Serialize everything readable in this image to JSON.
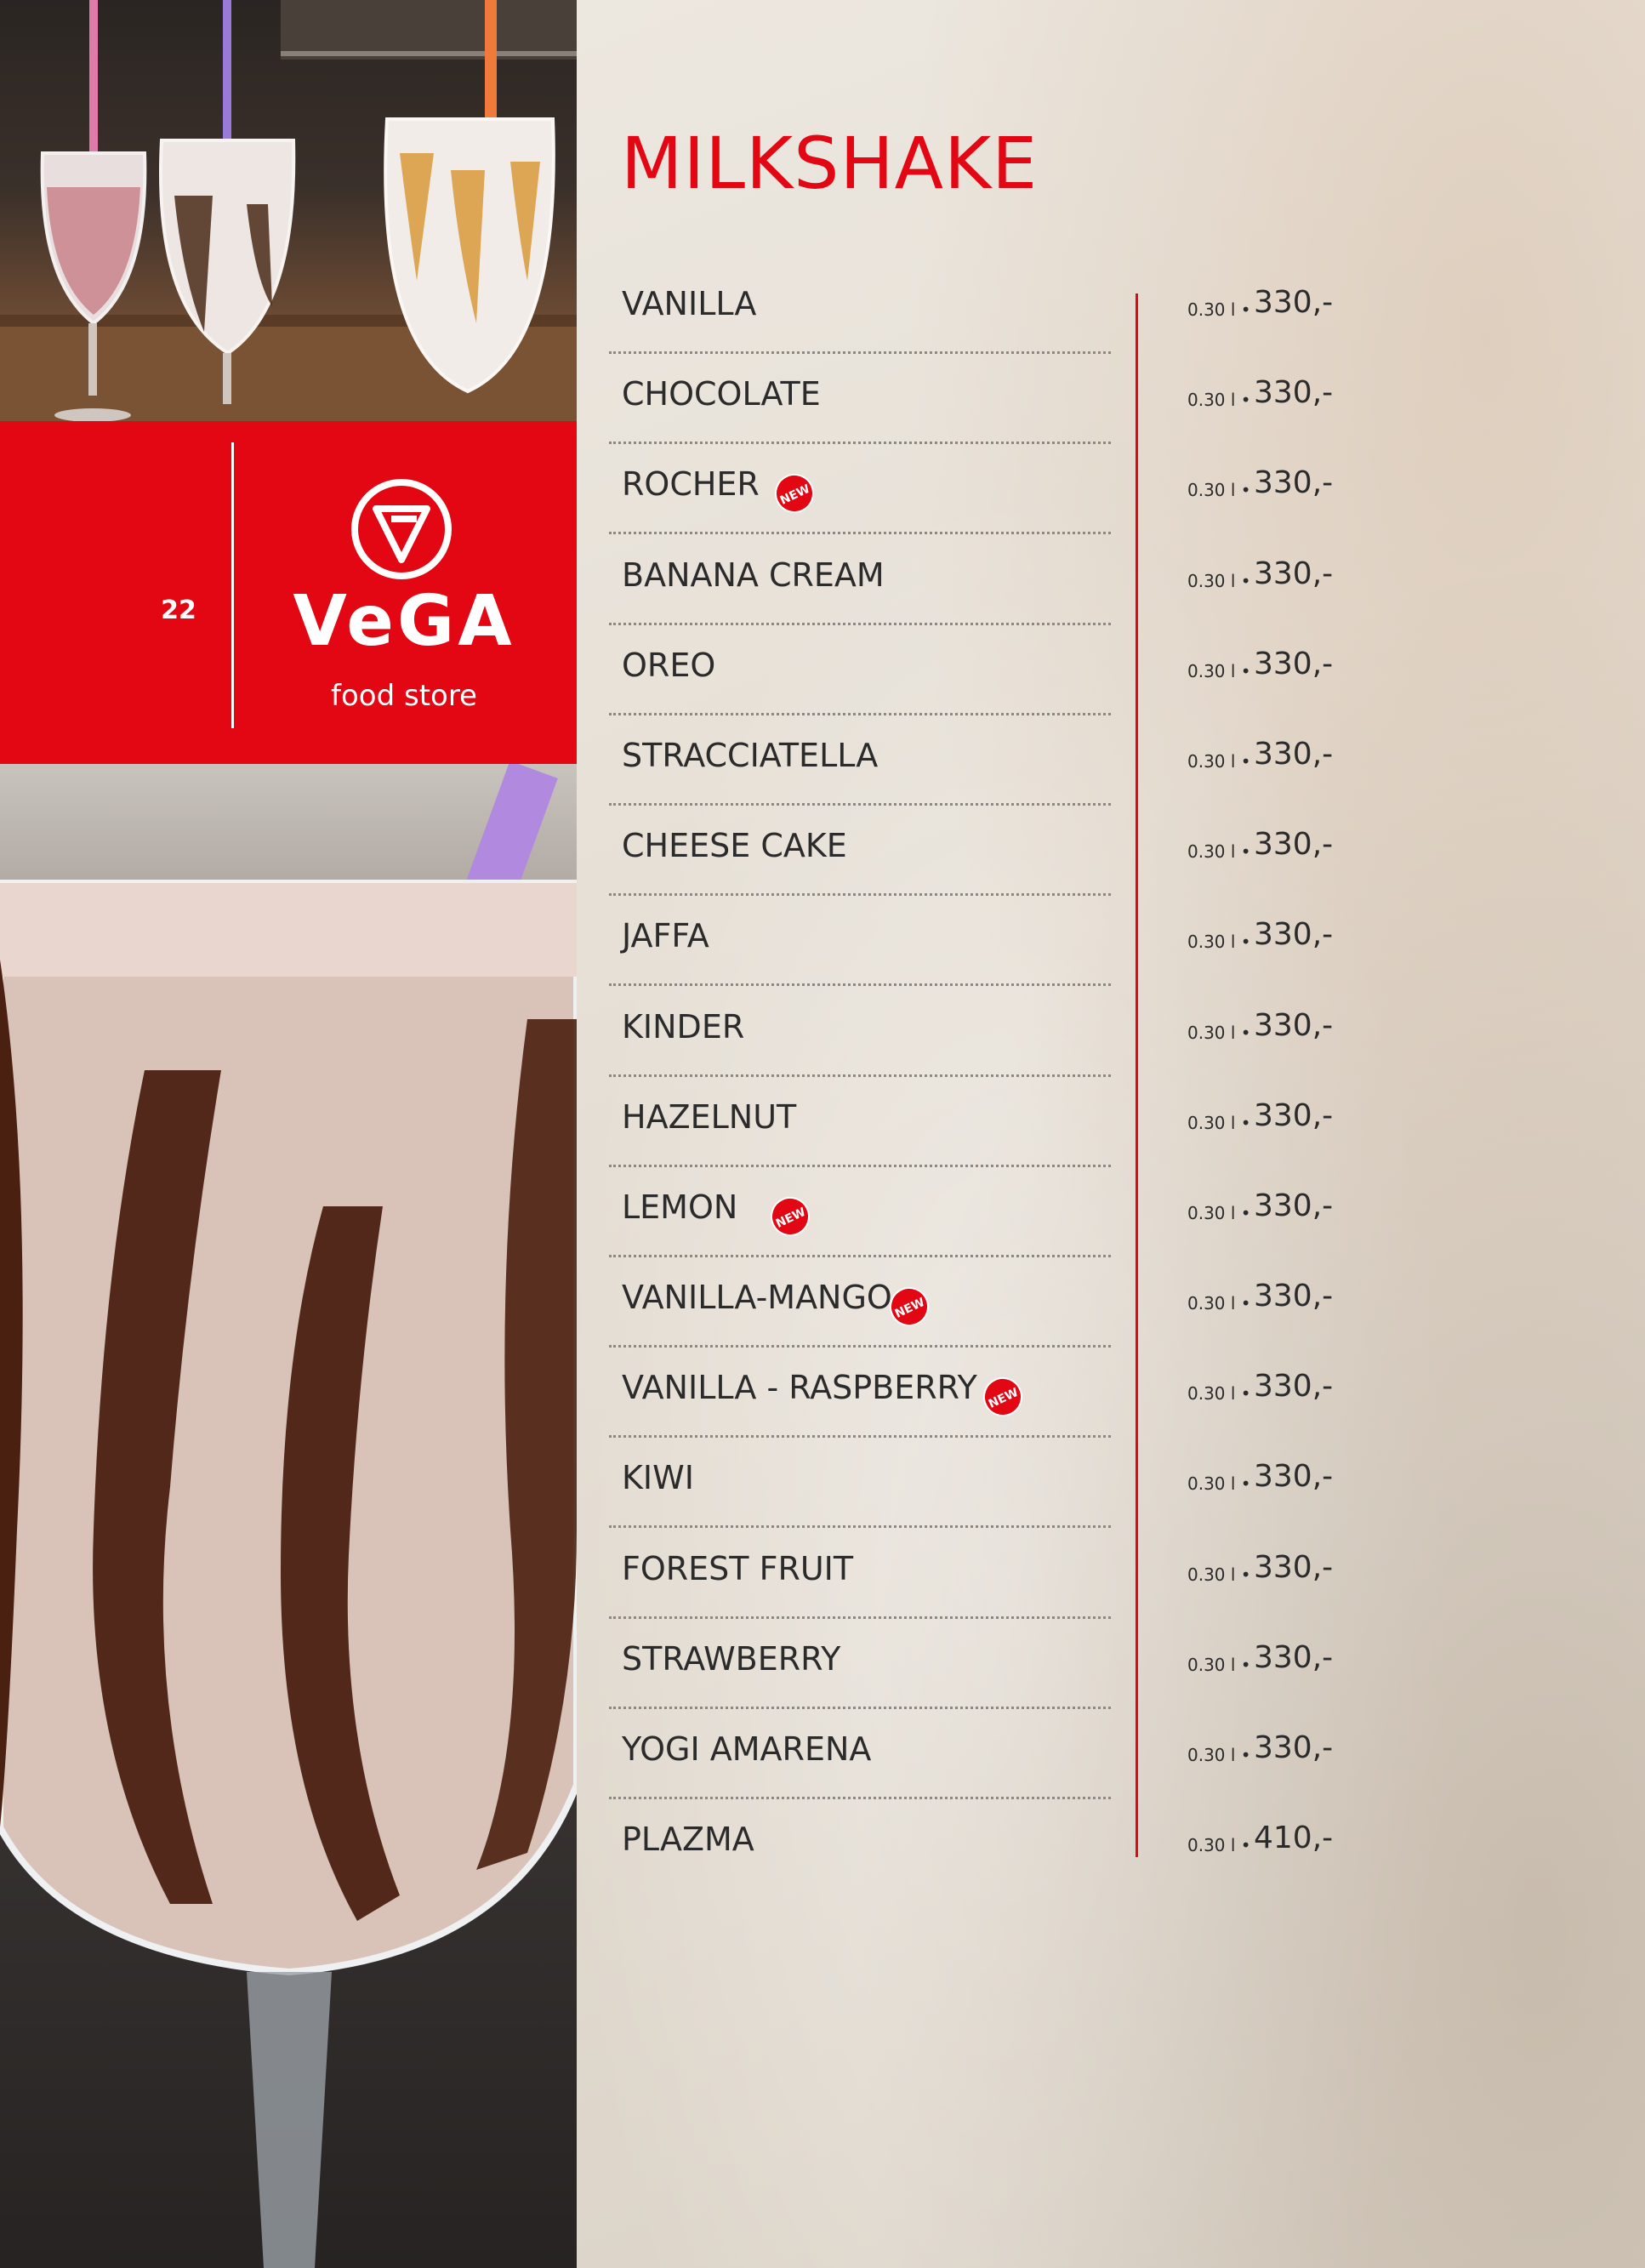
{
  "page_number": "22",
  "brand": {
    "name": "VeGA",
    "tagline": "food store",
    "color": "#e30613"
  },
  "menu": {
    "title": "MILKSHAKE",
    "badge_label": "NEW",
    "items": [
      {
        "name": "VANILLA",
        "volume": "0.30 l •",
        "price": "330,-",
        "is_new": false
      },
      {
        "name": "CHOCOLATE",
        "volume": "0.30 l •",
        "price": "330,-",
        "is_new": false
      },
      {
        "name": "ROCHER",
        "volume": "0.30 l •",
        "price": "330,-",
        "is_new": true
      },
      {
        "name": "BANANA CREAM",
        "volume": "0.30 l •",
        "price": "330,-",
        "is_new": false
      },
      {
        "name": "OREO",
        "volume": "0.30 l •",
        "price": "330,-",
        "is_new": false
      },
      {
        "name": "STRACCIATELLA",
        "volume": "0.30 l •",
        "price": "330,-",
        "is_new": false
      },
      {
        "name": "CHEESE CAKE",
        "volume": "0.30 l •",
        "price": "330,-",
        "is_new": false
      },
      {
        "name": "JAFFA",
        "volume": "0.30 l •",
        "price": "330,-",
        "is_new": false
      },
      {
        "name": "KINDER",
        "volume": "0.30 l •",
        "price": "330,-",
        "is_new": false
      },
      {
        "name": "HAZELNUT",
        "volume": "0.30 l •",
        "price": "330,-",
        "is_new": false
      },
      {
        "name": "LEMON",
        "volume": "0.30 l •",
        "price": "330,-",
        "is_new": true
      },
      {
        "name": "VANILLA-MANGO",
        "volume": "0.30 l •",
        "price": "330,-",
        "is_new": true
      },
      {
        "name": "VANILLA - RASPBERRY",
        "volume": "0.30 l •",
        "price": "330,-",
        "is_new": true
      },
      {
        "name": "KIWI",
        "volume": "0.30 l •",
        "price": "330,-",
        "is_new": false
      },
      {
        "name": "FOREST FRUIT",
        "volume": "0.30 l •",
        "price": "330,-",
        "is_new": false
      },
      {
        "name": "STRAWBERRY",
        "volume": "0.30 l •",
        "price": "330,-",
        "is_new": false
      },
      {
        "name": "YOGI AMARENA",
        "volume": "0.30 l •",
        "price": "330,-",
        "is_new": false
      },
      {
        "name": "PLAZMA",
        "volume": "0.30 l •",
        "price": "410,-",
        "is_new": false
      }
    ]
  },
  "images": {
    "top_photo": "three-milkshakes-photo",
    "bottom_photo": "chocolate-milkshake-closeup-photo"
  }
}
